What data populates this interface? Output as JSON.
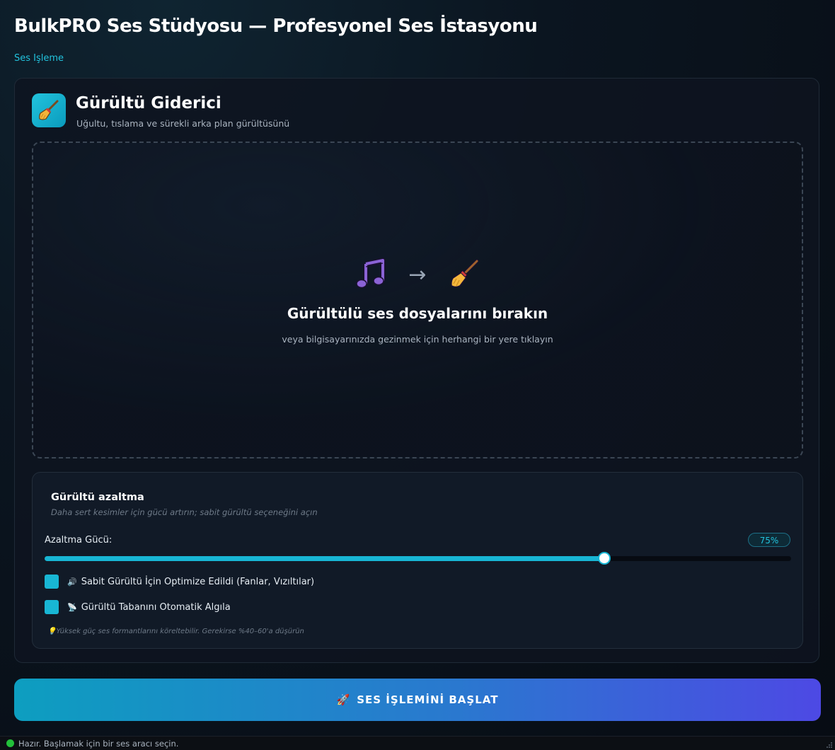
{
  "header": {
    "title": "BulkPRO Ses Stüdyosu — Profesyonel Ses İstasyonu",
    "breadcrumb": "Ses Işleme"
  },
  "tool": {
    "icon": "broom-icon",
    "title": "Gürültü Giderici",
    "subtitle": "Uğultu, tıslama ve sürekli arka plan gürültüsünü"
  },
  "dropzone": {
    "icons": [
      "music-note-icon",
      "arrow-right-icon",
      "broom-icon"
    ],
    "arrow": "→",
    "title": "Gürültülü ses dosyalarını bırakın",
    "subtitle": "veya bilgisayarınızda gezinmek için herhangi bir yere tıklayın"
  },
  "settings": {
    "title": "Gürültü azaltma",
    "subtitle": "Daha sert kesimler için gücü artırın; sabit gürültü seçeneğini açın",
    "strength_label": "Azaltma Gücü:",
    "strength_value": 75,
    "strength_display": "75%",
    "options": [
      {
        "emoji": "🔊",
        "icon": "speaker-icon",
        "label": "Sabit Gürültü İçin Optimize Edildi (Fanlar, Vızıltılar)",
        "checked": true
      },
      {
        "emoji": "📡",
        "icon": "satellite-icon",
        "label": "Gürültü Tabanını Otomatik Algıla",
        "checked": true
      }
    ],
    "hint_emoji": "💡",
    "hint": "Yüksek güç ses formantlarını köreltebilir. Gerekirse %40–60'a düşürün"
  },
  "action": {
    "emoji": "🚀",
    "label": "SES İŞLEMİNİ BAŞLAT"
  },
  "status": {
    "text": "Hazır. Başlamak için bir ses aracı seçin.",
    "color": "#22c03a"
  },
  "colors": {
    "accent": "#18b6d4",
    "gradient_start": "#0d9ec0",
    "gradient_end": "#4d49e4"
  }
}
